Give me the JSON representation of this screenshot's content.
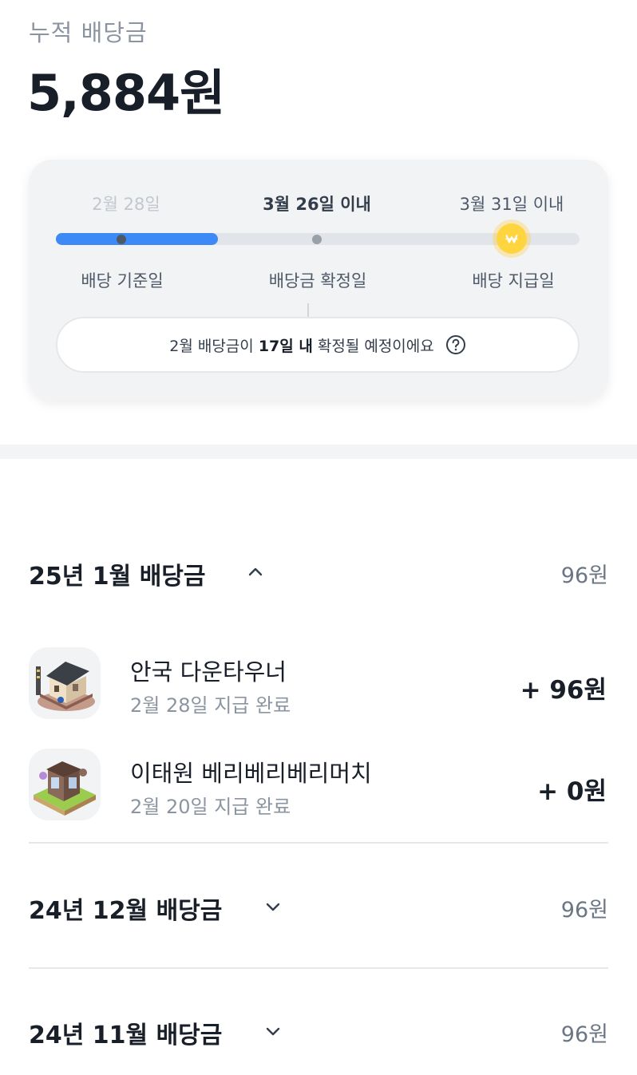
{
  "summary": {
    "label": "누적 배당금",
    "total": "5,884원"
  },
  "timeline": {
    "dates": [
      "2월 28일",
      "3월 26일 이내",
      "3월 31일 이내"
    ],
    "labels": [
      "배당 기준일",
      "배당금 확정일",
      "배당 지급일"
    ],
    "progress_fraction": 0.31,
    "notice": {
      "prefix": "2월 배당금이 ",
      "bold": "17일 내",
      "suffix": " 확정될 예정이에요"
    },
    "colors": {
      "progress": "#3d8af7",
      "coin": "#ffd53f"
    },
    "coin_icon": "won-coin-icon",
    "help_icon": "question-circle-icon"
  },
  "groups": [
    {
      "title": "25년 1월 배당금",
      "amount": "96원",
      "expanded": true,
      "chevron": "chevron-up-icon",
      "items": [
        {
          "name": "안국 다운타우너",
          "status": "2월 28일 지급 완료",
          "amount": "+ 96원"
        },
        {
          "name": "이태원 베리베리베리머치",
          "status": "2월 20일 지급 완료",
          "amount": "+ 0원"
        }
      ]
    },
    {
      "title": "24년 12월 배당금",
      "amount": "96원",
      "expanded": false,
      "chevron": "chevron-down-icon"
    },
    {
      "title": "24년 11월 배당금",
      "amount": "96원",
      "expanded": false,
      "chevron": "chevron-down-icon"
    }
  ]
}
